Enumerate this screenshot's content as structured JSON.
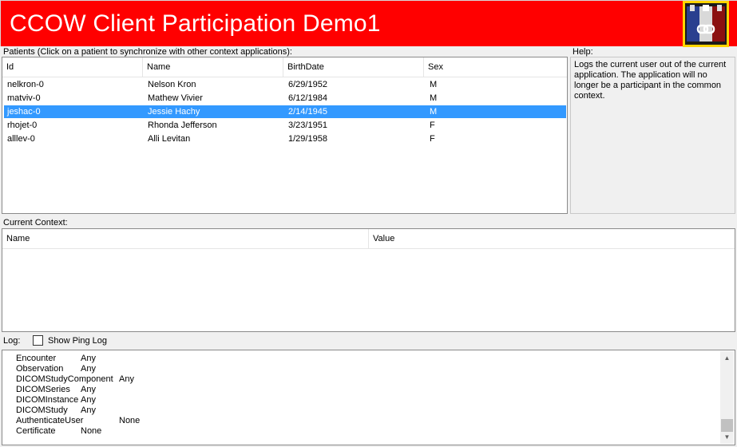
{
  "banner": {
    "title": "CCOW Client Participation Demo1",
    "bg": "#ff0000",
    "logo_icon": "chain-link-logo-icon"
  },
  "patients": {
    "label": "Patients (Click on a patient to synchronize with other context applications):",
    "columns": [
      "Id",
      "Name",
      "BirthDate",
      "Sex"
    ],
    "rows": [
      [
        "nelkron-0",
        "Nelson Kron",
        "6/29/1952",
        "M"
      ],
      [
        "matviv-0",
        "Mathew Vivier",
        "6/12/1984",
        "M"
      ],
      [
        "jeshac-0",
        "Jessie Hachy",
        "2/14/1945",
        "M"
      ],
      [
        "rhojet-0",
        "Rhonda Jefferson",
        "3/23/1951",
        "F"
      ],
      [
        "alllev-0",
        "Alli Levitan",
        "1/29/1958",
        "F"
      ]
    ],
    "selected_index": 2,
    "selection_color": "#3399ff"
  },
  "help": {
    "label": "Help:",
    "text": "Logs the current user out of the current application.  The application will no longer be a participant in the common context."
  },
  "context": {
    "label": "Current Context:",
    "columns": [
      "Name",
      "Value"
    ]
  },
  "log": {
    "label": "Log:",
    "show_ping_label": "Show Ping Log",
    "show_ping_checked": false,
    "lines": [
      [
        "Encounter",
        "Any"
      ],
      [
        "Observation",
        "Any"
      ],
      [
        "DICOMStudyComponent",
        "Any"
      ],
      [
        "DICOMSeries",
        "Any"
      ],
      [
        "DICOMInstance",
        "Any"
      ],
      [
        "DICOMStudy",
        "Any"
      ],
      [
        "AuthenticateUser",
        "None"
      ],
      [
        "Certificate",
        "None"
      ]
    ]
  }
}
